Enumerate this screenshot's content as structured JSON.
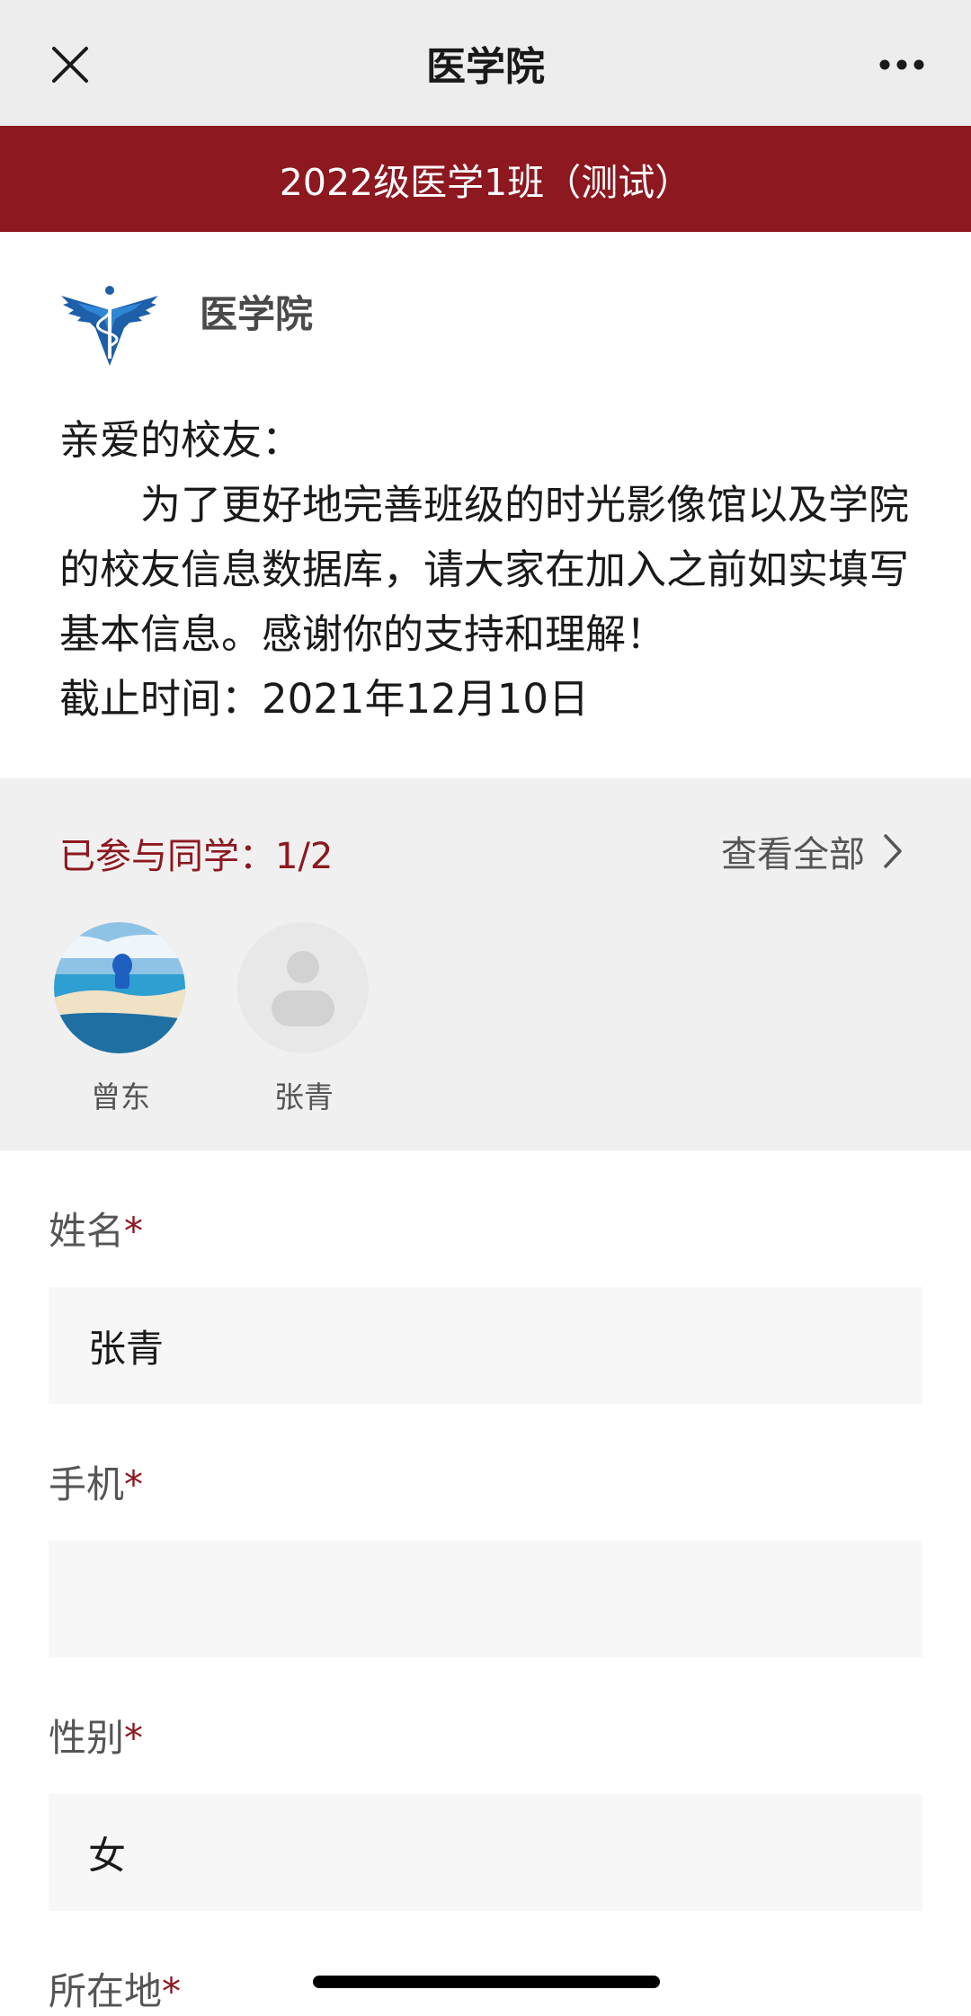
{
  "topbar": {
    "title": "医学院",
    "close_icon": "close-icon",
    "more_icon": "more-icon"
  },
  "banner": {
    "text": "2022级医学1班（测试）"
  },
  "org": {
    "name": "医学院",
    "logo_icon": "caduceus-logo"
  },
  "notice": {
    "greeting": "亲爱的校友：",
    "body": "为了更好地完善班级的时光影像馆以及学院的校友信息数据库，请大家在加入之前如实填写基本信息。感谢你的支持和理解！",
    "deadline": "截止时间：2021年12月10日"
  },
  "participants": {
    "count_label": "已参与同学：1/2",
    "view_all": "查看全部",
    "people": [
      {
        "name": "曾东",
        "avatar": "beach-photo"
      },
      {
        "name": "张青",
        "avatar": "default-avatar"
      }
    ]
  },
  "form": {
    "fields": [
      {
        "label": "姓名",
        "required": "*",
        "value": "张青"
      },
      {
        "label": "手机",
        "required": "*",
        "value": ""
      },
      {
        "label": "性别",
        "required": "*",
        "value": "女"
      },
      {
        "label": "所在地",
        "required": "*"
      }
    ]
  },
  "colors": {
    "accent": "#8d1820",
    "topbar_bg": "#ededed",
    "section_bg": "#f0f0f0",
    "input_bg": "#f7f7f7"
  }
}
